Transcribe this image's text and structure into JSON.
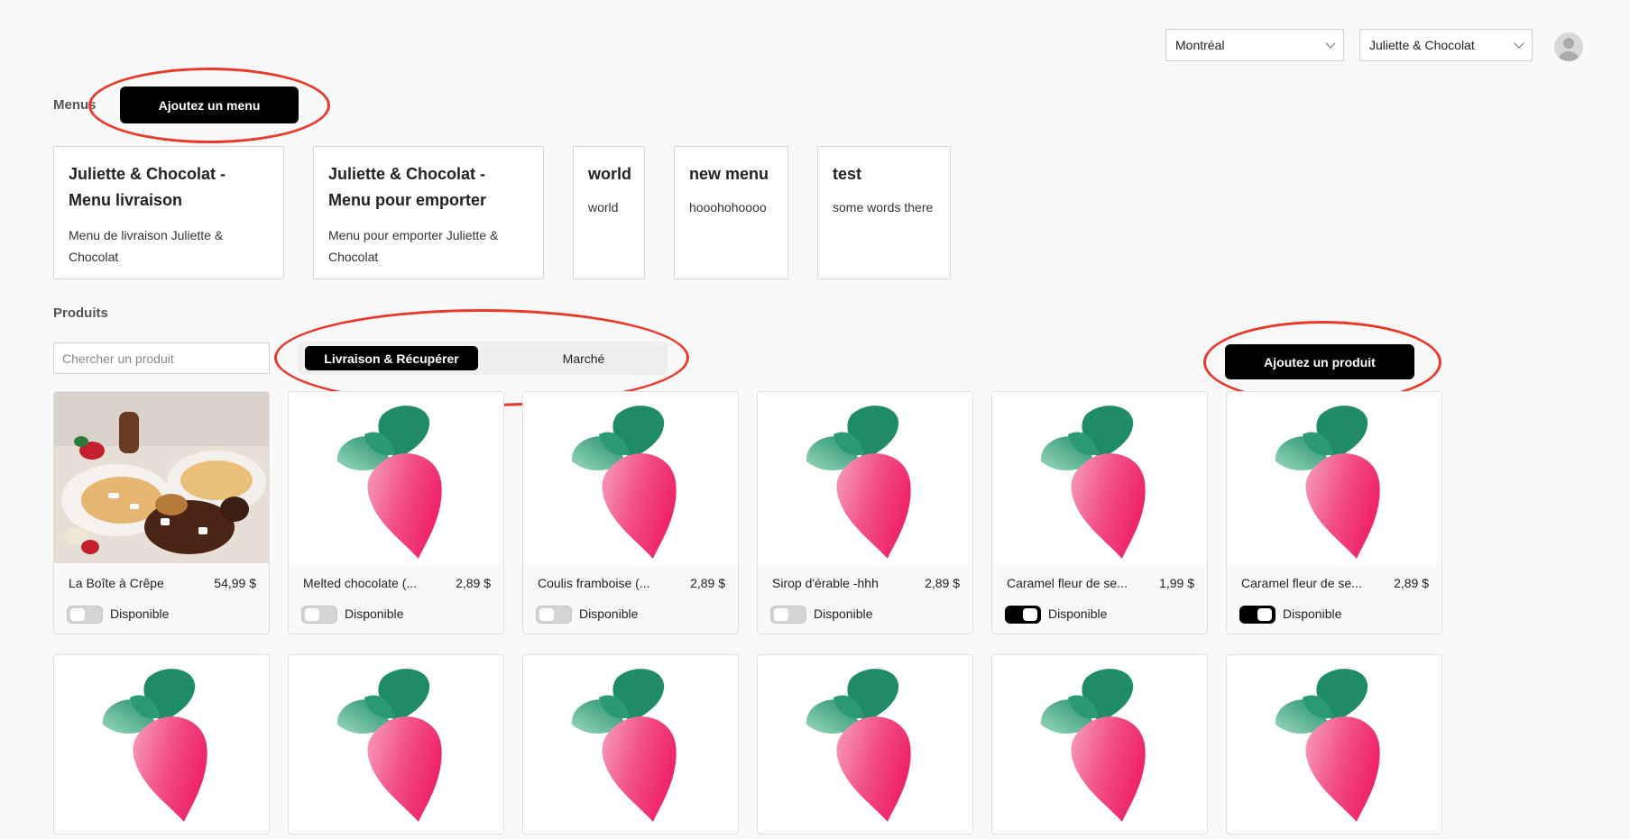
{
  "header": {
    "city_select": "Montréal",
    "shop_select": "Juliette & Chocolat",
    "avatar_icon": "user-avatar-icon"
  },
  "menus": {
    "label": "Menus",
    "add_button": "Ajoutez un menu",
    "items": [
      {
        "title": "Juliette & Chocolat - Menu livraison",
        "desc": "Menu de livraison Juliette & Chocolat"
      },
      {
        "title": "Juliette & Chocolat - Menu pour emporter",
        "desc": "Menu pour emporter Juliette & Chocolat"
      },
      {
        "title": "world",
        "desc": "world"
      },
      {
        "title": "new menu",
        "desc": "hooohohoooo"
      },
      {
        "title": "test",
        "desc": "some words there"
      }
    ]
  },
  "products": {
    "label": "Produits",
    "search_placeholder": "Chercher un produit",
    "tabs": [
      "Livraison & Récupérer",
      "Marché"
    ],
    "add_button": "Ajoutez un produit",
    "available_label": "Disponible",
    "items": [
      {
        "name": "La Boîte à Crêpe",
        "price": "54,99 $",
        "available": false,
        "image": "crepe-photo"
      },
      {
        "name": "Melted chocolate (...",
        "price": "2,89 $",
        "available": false,
        "image": "radish-logo"
      },
      {
        "name": "Coulis framboise (...",
        "price": "2,89 $",
        "available": false,
        "image": "radish-logo"
      },
      {
        "name": "Sirop d'érable -hhh",
        "price": "2,89 $",
        "available": false,
        "image": "radish-logo"
      },
      {
        "name": "Caramel fleur de se...",
        "price": "1,99 $",
        "available": true,
        "image": "radish-logo"
      },
      {
        "name": "Caramel fleur de se...",
        "price": "2,89 $",
        "available": true,
        "image": "radish-logo"
      }
    ]
  },
  "colors": {
    "annotation": "#e8392a",
    "leaf_green": "#1a8a63",
    "radish_pink": "#f0306f"
  }
}
